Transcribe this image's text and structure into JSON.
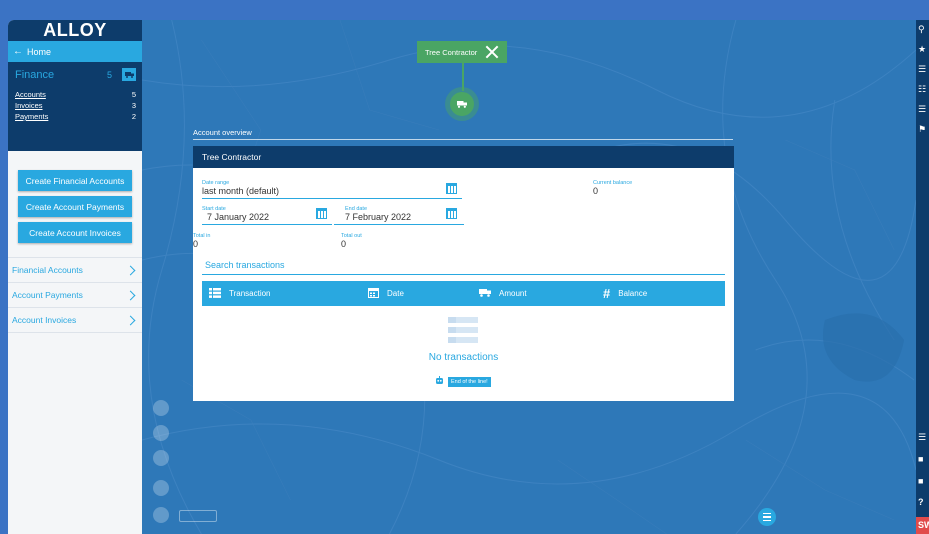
{
  "app": {
    "logo": "ALLOY"
  },
  "sidebar": {
    "home_label": "Home",
    "finance": {
      "title": "Finance",
      "count": "5",
      "links": [
        {
          "label": "Accounts",
          "count": "5"
        },
        {
          "label": "Invoices",
          "count": "3"
        },
        {
          "label": "Payments",
          "count": "2"
        }
      ]
    },
    "buttons": [
      {
        "label": "Create Financial Accounts"
      },
      {
        "label": "Create Account Payments"
      },
      {
        "label": "Create Account Invoices"
      }
    ],
    "nav": [
      {
        "label": "Financial Accounts"
      },
      {
        "label": "Account Payments"
      },
      {
        "label": "Account Invoices"
      }
    ]
  },
  "map_tag": {
    "label": "Tree Contractor"
  },
  "account": {
    "section_label": "Account overview",
    "title": "Tree Contractor",
    "date_range": {
      "label": "Date range",
      "value": "last month (default)"
    },
    "current_balance": {
      "label": "Current balance",
      "value": "0"
    },
    "start_date": {
      "label": "Start date",
      "value": "7 January 2022"
    },
    "end_date": {
      "label": "End date",
      "value": "7 February 2022"
    },
    "total_in": {
      "label": "Total in",
      "value": "0"
    },
    "total_out": {
      "label": "Total out",
      "value": "0"
    },
    "search_placeholder": "Search transactions",
    "columns": [
      {
        "label": "Transaction",
        "icon": "list-icon"
      },
      {
        "label": "Date",
        "icon": "calendar-icon"
      },
      {
        "label": "Amount",
        "icon": "truck-icon"
      },
      {
        "label": "Balance",
        "icon": "hash-icon"
      }
    ],
    "empty_text": "No transactions",
    "end_of_line": "End of the line!"
  },
  "right_strip": {
    "sw_label": "SW"
  },
  "colors": {
    "navy": "#0d3c6b",
    "accent": "#29a8e0",
    "green": "#4aa564",
    "sw_red": "#e14b4b"
  }
}
